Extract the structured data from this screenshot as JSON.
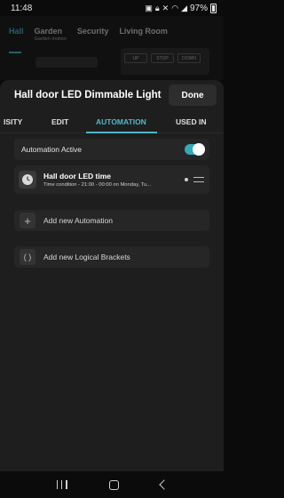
{
  "status_bar": {
    "time": "11:48",
    "battery": "97%",
    "icons": [
      "image-icon",
      "lock-icon",
      "mute-icon",
      "wifi-icon",
      "signal-icon",
      "battery-icon"
    ]
  },
  "background_app": {
    "tabs": [
      {
        "label": "Hall",
        "sub": ""
      },
      {
        "label": "Garden",
        "sub": "Garden motion"
      },
      {
        "label": "Security",
        "sub": ""
      },
      {
        "label": "Living Room",
        "sub": ""
      }
    ],
    "buttons": [
      "UP",
      "STOP",
      "DOWN"
    ],
    "accent": "#38a7b8"
  },
  "sheet": {
    "title": "Hall door LED Dimmable Light",
    "done_label": "Done",
    "tabs": [
      "ISITY",
      "EDIT",
      "AUTOMATION",
      "USED IN"
    ],
    "active_tab": "AUTOMATION",
    "automation_active_label": "Automation Active",
    "automation_active": true,
    "automations": [
      {
        "name": "Hall door LED time",
        "description": "Time condition - 21:00 - 00:00 on Monday, Tu...",
        "icon": "clock-icon"
      }
    ],
    "add_automation_label": "Add new Automation",
    "add_brackets_label": "Add new Logical Brackets"
  },
  "colors": {
    "accent": "#4fb8c8",
    "sheet_bg": "#1e1e1e",
    "row_bg": "#262626"
  }
}
